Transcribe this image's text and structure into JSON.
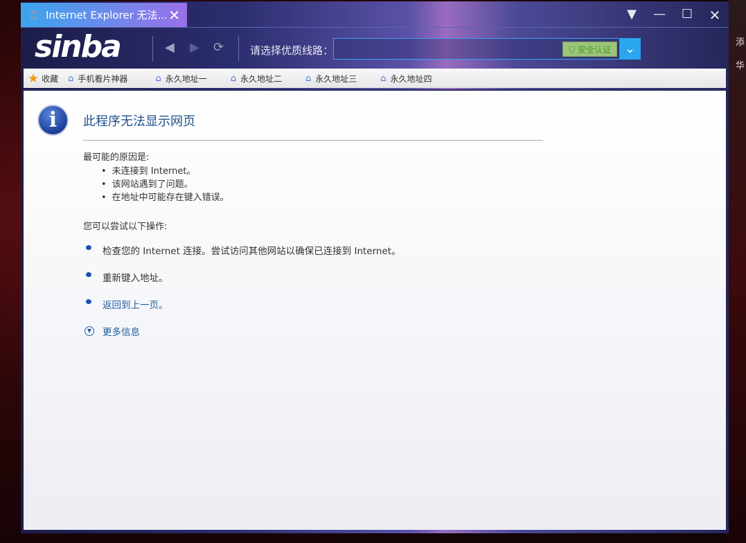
{
  "desktop": {
    "frag1": "添",
    "frag2": "华"
  },
  "tab": {
    "title": "Internet Explorer 无法...",
    "favicon": "sinba-favicon",
    "close": "✕"
  },
  "window_controls": {
    "menu": "▼",
    "minimize": "—",
    "maximize": "☐",
    "close": "✕"
  },
  "toolbar": {
    "logo": "sinba",
    "back": "◀",
    "forward": "▶",
    "refresh": "⟳",
    "route_label": "请选择优质线路：",
    "route_value": "",
    "security_badge": "安全认证",
    "dropdown": "⌄"
  },
  "bookmarks": {
    "favorites": "收藏",
    "items": [
      "手机看片神器",
      "永久地址一",
      "永久地址二",
      "永久地址三",
      "永久地址四"
    ]
  },
  "page": {
    "title": "此程序无法显示网页",
    "causes_heading": "最可能的原因是:",
    "causes": [
      "未连接到 Internet。",
      "该网站遇到了问题。",
      "在地址中可能存在键入错误。"
    ],
    "actions_heading": "您可以尝试以下操作:",
    "actions": [
      "检查您的 Internet 连接。尝试访问其他网站以确保已连接到 Internet。",
      "重新键入地址。",
      "返回到上一页。"
    ],
    "more_info": "更多信息"
  }
}
